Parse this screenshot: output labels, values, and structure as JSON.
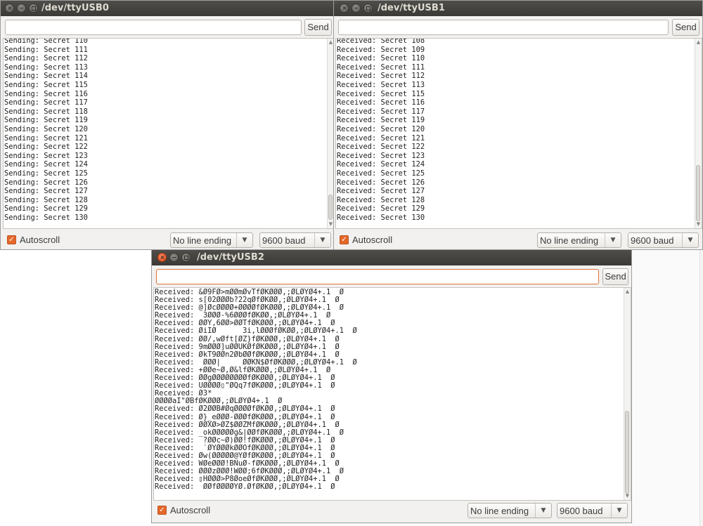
{
  "colors": {
    "titlebar": "#3c3b37",
    "accent_orange": "#e4682a",
    "desktop": "#fafafa"
  },
  "windows": [
    {
      "title": "/dev/ttyUSB0",
      "input_value": "",
      "send_label": "Send",
      "lines": [
        "Sending: Secret 110",
        "Sending: Secret 111",
        "Sending: Secret 112",
        "Sending: Secret 113",
        "Sending: Secret 114",
        "Sending: Secret 115",
        "Sending: Secret 116",
        "Sending: Secret 117",
        "Sending: Secret 118",
        "Sending: Secret 119",
        "Sending: Secret 120",
        "Sending: Secret 121",
        "Sending: Secret 122",
        "Sending: Secret 123",
        "Sending: Secret 124",
        "Sending: Secret 125",
        "Sending: Secret 126",
        "Sending: Secret 127",
        "Sending: Secret 128",
        "Sending: Secret 129",
        "Sending: Secret 130"
      ],
      "autoscroll_label": "Autoscroll",
      "autoscroll_checked": true,
      "line_ending": "No line ending",
      "baud": "9600 baud"
    },
    {
      "title": "/dev/ttyUSB1",
      "input_value": "",
      "send_label": "Send",
      "lines": [
        "Received: Secret 108",
        "Received: Secret 109",
        "Received: Secret 110",
        "Received: Secret 111",
        "Received: Secret 112",
        "Received: Secret 113",
        "Received: Secret 115",
        "Received: Secret 116",
        "Received: Secret 117",
        "Received: Secret 119",
        "Received: Secret 120",
        "Received: Secret 121",
        "Received: Secret 122",
        "Received: Secret 123",
        "Received: Secret 124",
        "Received: Secret 125",
        "Received: Secret 126",
        "Received: Secret 127",
        "Received: Secret 128",
        "Received: Secret 129",
        "Received: Secret 130"
      ],
      "autoscroll_label": "Autoscroll",
      "autoscroll_checked": true,
      "line_ending": "No line ending",
      "baud": "9600 baud"
    },
    {
      "title": "/dev/ttyUSB2",
      "input_value": "",
      "send_label": "Send",
      "lines": [
        "Received: &Ø9FØ>mØØmØvTfØKØØØ,;ØLØYØ4+.1  Ø",
        "Received: s[02ØØØb?22qØfØKØØ,;ØLØYØ4+.1  Ø",
        "Received: @]ØcØØØØ+ØØØØfØKØØØ,;ØLØYØ4+.1  Ø",
        "Received:  3ØØØ-%6ØØØfØKØØ,;ØLØYØ4+.1  Ø",
        "Received: ØØY,6ØØ>ØØTfØKØØØ,;ØLØYØ4+.1  Ø",
        "Received: ØiIØ      3i,lØØØfØKØØ,;ØLØYØ4+.1  Ø",
        "Received: ØØ/,wØft[ØZ}fØKØØØ,;ØLØYØ4+.1  Ø",
        "Received: 9mØØØ]uØØUKØfØKØØØ,;ØLØYØ4+.1  Ø",
        "Received: ØkT9ØØn2ØbØØfØKØØØ,;ØLØYØ4+.1  Ø",
        "Received:  ØØØ|     ØØKN$ØfØKØØØ,;ØLØYØ4+.1  Ø",
        "Received: +ØØe~Ø,Ø&lfØKØØØ,;ØLØYØ4+.1  Ø",
        "Received: ØØgØØØØØØØØfØKØØØ,;ØLØYØ4+.1  Ø",
        "Received: UØØØØ▯\"ØQq7fØKØØØ,;ØLØYØ4+.1  Ø",
        "Received: Ø3*",
        "ØØØØaI\"ØBfØKØØØ,;ØLØYØ4+.1  Ø",
        "Received: Ø2ØØB#ØqØØØØfØKØØ,;ØLØYØ4+.1  Ø",
        "Received: Ø}_eØØØ-ØØØfØKØØØ,;ØLØYØ4+.1  Ø",
        "Received: ØØXØ>ØZ$ØØZMfØKØØØ,;ØLØYØ4+.1  Ø",
        "Received: _okØØØØØg&|ØØfØKØØØ,;ØLØYØ4+.1  Ø",
        "Received:  ?ØØc~Ø)ØØ!fØKØØØ,;ØLØYØ4+.1  Ø",
        "Received:  `ØYØØØkØØOfØKØØØ,;ØLØYØ4+.1  Ø",
        "Received: Øw(ØØØØØ@YØfØKØØØ,;ØLØYØ4+.1  Ø",
        "Received: WØeØØØ!BNuØ-fØKØØØ,;ØLØYØ4+.1  Ø",
        "Received: ØØØzØØØ!WØØ;6fØKØØØ,;ØLØYØ4+.1  Ø",
        "Received: ▯HØØØ>P8ØoeØfØKØØØ,;ØLØYØ4+.1  Ø",
        "Received:  ØØfØØØØYØ.ØfØKØØ,;ØLØYØ4+.1  Ø"
      ],
      "autoscroll_label": "Autoscroll",
      "autoscroll_checked": true,
      "line_ending": "No line ending",
      "baud": "9600 baud"
    }
  ]
}
